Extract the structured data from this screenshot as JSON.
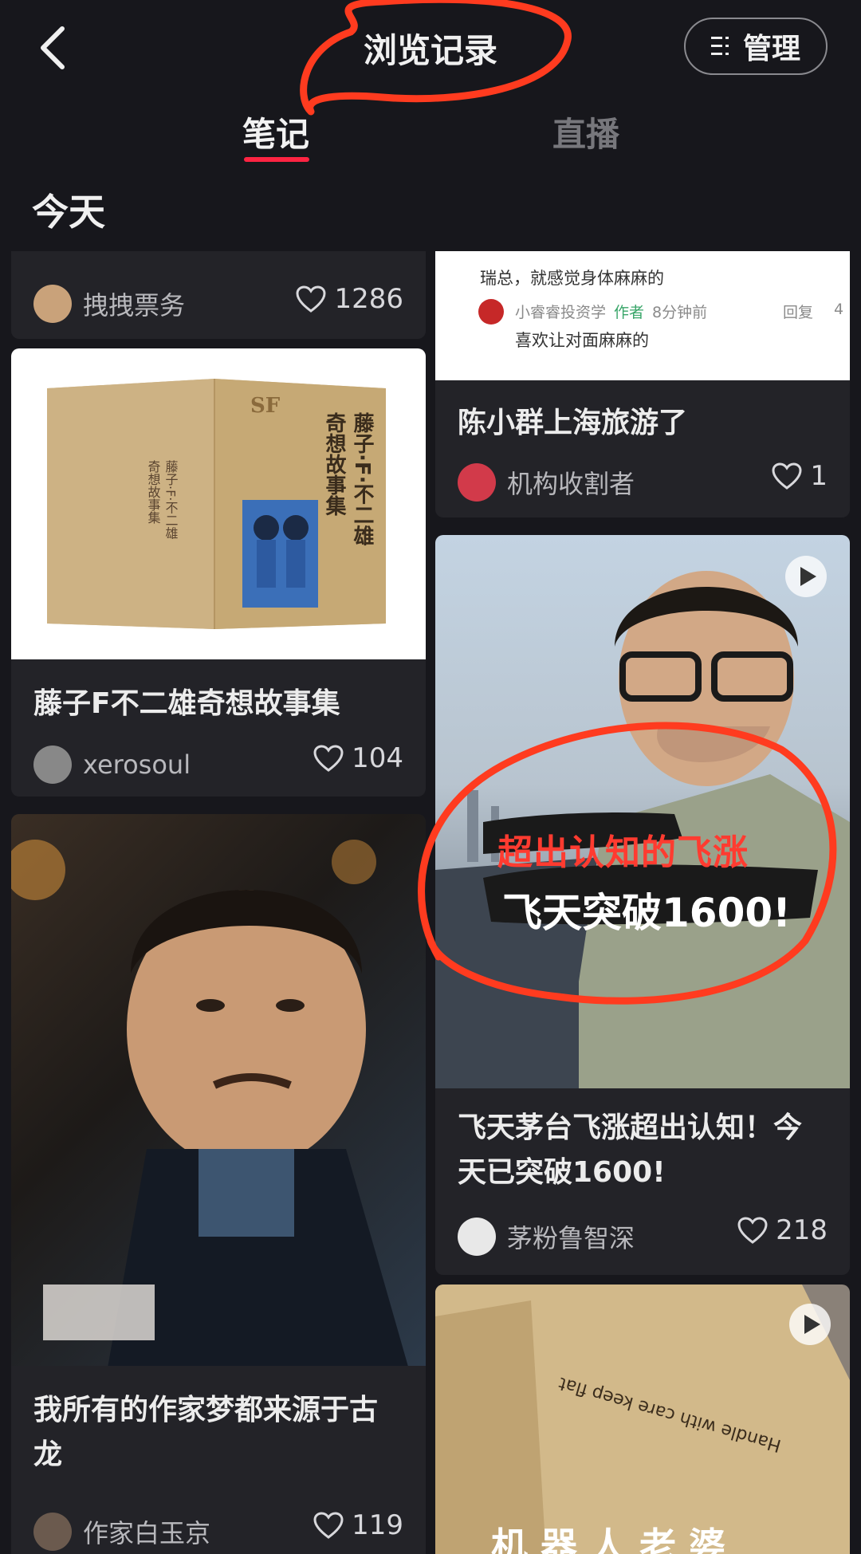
{
  "header": {
    "title": "浏览记录",
    "manage_label": "管理"
  },
  "tabs": [
    {
      "label": "笔记",
      "active": true
    },
    {
      "label": "直播",
      "active": false
    }
  ],
  "section": "今天",
  "left_column": [
    {
      "author": "拽拽票务",
      "likes": "1286"
    },
    {
      "title": "藤子F不二雄奇想故事集",
      "author": "xerosoul",
      "likes": "104",
      "image": {
        "cover_title": "藤子·F·不二雄 奇想故事集",
        "logo": "SF"
      }
    },
    {
      "title_line1": "我所有的作家梦都来源于古",
      "title_line2": "龙",
      "author": "作家白玉京",
      "likes": "119"
    }
  ],
  "right_column": [
    {
      "comment_top": "瑞总，就感觉身体麻麻的",
      "reply": {
        "user": "小睿睿投资学",
        "role": "作者",
        "time": "8分钟前",
        "action": "回复",
        "count": "4",
        "text": "喜欢让对面麻麻的"
      },
      "title": "陈小群上海旅游了",
      "author": "机构收割者",
      "likes": "1"
    },
    {
      "overlay_line1": "超出认知的飞涨",
      "overlay_line2": "飞天突破1600!",
      "title_line1": "飞天茅台飞涨超出认知！今",
      "title_line2": "天已突破1600!",
      "author": "茅粉鲁智深",
      "likes": "218"
    },
    {
      "box_text": "Handle with care keep flat",
      "bottom_text": "机 器 人 老 婆"
    }
  ],
  "colors": {
    "accent": "#ff2442",
    "annotation": "#ff3b1f",
    "background": "#17171c",
    "card": "#232328"
  }
}
